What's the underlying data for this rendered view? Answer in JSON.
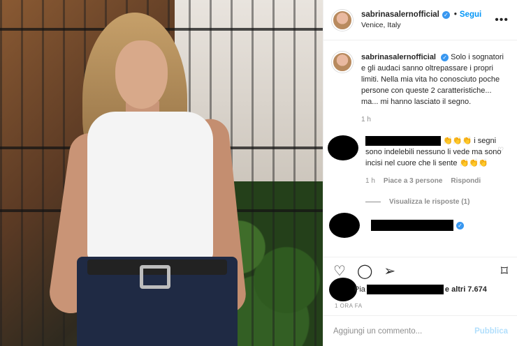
{
  "post": {
    "username": "sabrinasalernofficial",
    "follow_label": "Segui",
    "dot": "•",
    "location": "Venice, Italy",
    "more": "•••"
  },
  "caption": {
    "username": "sabrinasalernofficial",
    "text": "Solo i sognatori e gli audaci sanno oltrepassare i propri limiti. Nella mia vita ho conosciuto poche persone con queste 2 caratteristiche... ma... mi hanno lasciato il segno.",
    "time": "1 h"
  },
  "comment1": {
    "claps_top": "👏👏👏",
    "text": "i segni sono indelebili nessuno li vede ma sono incisi nel cuore che li sente",
    "claps_end": "👏👏👏",
    "time": "1 h",
    "likes": "Piace a 3 persone",
    "reply": "Rispondi",
    "view_replies": "Visualizza le risposte (1)"
  },
  "likes": {
    "prefix": "Pia",
    "suffix": "e altri 7.674"
  },
  "timestamp": "1 ORA FA",
  "composer": {
    "placeholder": "Aggiungi un commento...",
    "publish": "Pubblica"
  },
  "icons": {
    "heart": "♡",
    "comment": "◯",
    "share": "➢",
    "bookmark": "⌑",
    "verified": "✓"
  }
}
